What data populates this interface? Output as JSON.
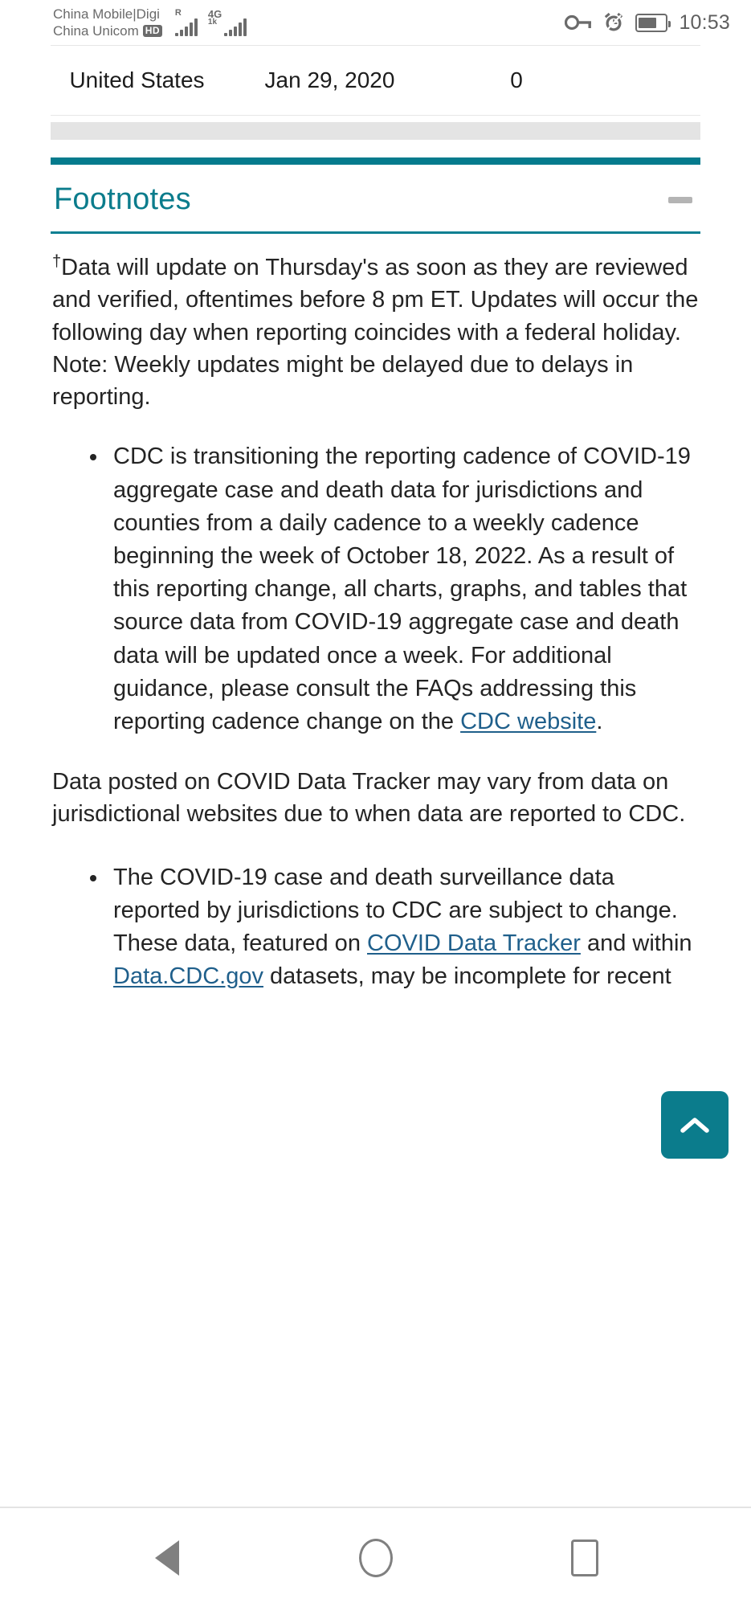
{
  "status_bar": {
    "carrier_line1": "China Mobile|Digi",
    "carrier_line2": "China Unicom",
    "hd_badge": "HD",
    "roaming_label": "R",
    "network_label": "4G",
    "network_label_2": "1k",
    "time": "10:53",
    "icons": [
      "key-icon",
      "alarm-icon",
      "battery-icon"
    ]
  },
  "table": {
    "row": {
      "location": "United States",
      "date": "Jan 29, 2020",
      "value": "0"
    }
  },
  "accordion": {
    "title": "Footnotes",
    "toggle_icon": "minus-icon",
    "expanded": true
  },
  "content": {
    "dagger": "†",
    "paragraph1": "Data will update on Thursday's as soon as they are reviewed and verified, oftentimes before 8 pm ET. Updates will occur the following day when reporting coincides with a federal holiday. Note: Weekly updates might be delayed due to delays in reporting.",
    "bullet1_part1": "CDC is transitioning the reporting cadence of COVID-19 aggregate case and death data for jurisdictions and counties from a daily cadence to a weekly cadence beginning the week of October 18, 2022. As a result of this reporting change, all charts, graphs, and tables that source data from COVID-19 aggregate case and death data will be updated once a week. For additional guidance, please consult the FAQs addressing this reporting cadence change on the ",
    "bullet1_link": "CDC website",
    "bullet1_part2": ".",
    "paragraph2": "Data posted on COVID Data Tracker may vary from data on jurisdictional websites due to when data are reported to CDC.",
    "bullet2_part1": "The COVID-19 case and death surveillance data reported by jurisdictions to CDC are subject to change. These data, featured on ",
    "bullet2_link1": "COVID Data Tracker",
    "bullet2_mid": " and within ",
    "bullet2_link2": "Data.CDC.gov",
    "bullet2_part2": " datasets, may be incomplete for recent"
  },
  "fab": {
    "label": "scroll-to-top",
    "icon": "chevron-up-icon",
    "color": "#0b7c8c"
  },
  "nav_bar": {
    "back": "back-icon",
    "home": "home-icon",
    "recents": "recents-icon"
  },
  "colors": {
    "accent_teal": "#0b7c8c",
    "link_blue": "#1f5f8b",
    "text": "#242424"
  }
}
